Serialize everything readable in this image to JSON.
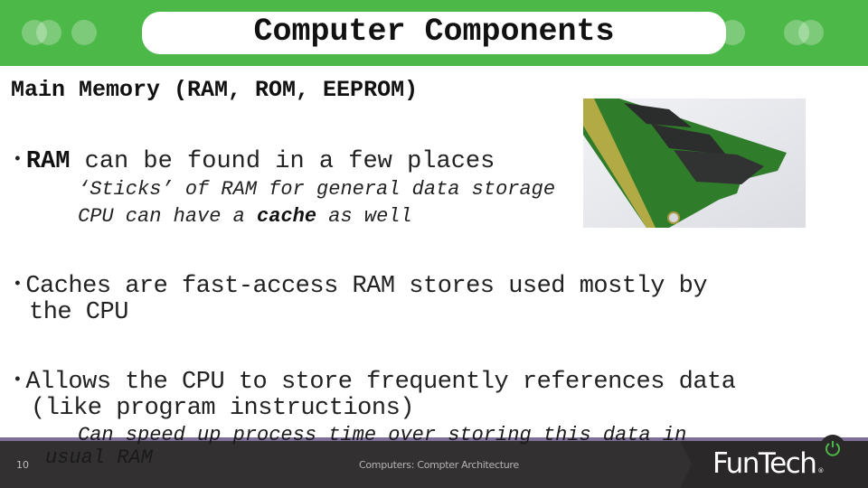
{
  "header": {
    "title": "Computer Components",
    "accent_color": "#4cb847"
  },
  "content": {
    "subtitle": "Main Memory (RAM, ROM, EEPROM)",
    "bullet1": {
      "bold": "RAM",
      "rest": " can be found in a few places",
      "subs": [
        {
          "text": "‘Sticks’ of RAM for general data storage"
        },
        {
          "pre": "CPU can have a ",
          "bold": "cache",
          "post": " as well"
        }
      ]
    },
    "bullet2": {
      "line1": "Caches are fast-access RAM stores used mostly by",
      "line2": "the CPU"
    },
    "bullet3": {
      "line1": "Allows the CPU to store frequently references data",
      "line2": "(like program instructions)",
      "sub_line1": "Can speed up process time over storing this data in",
      "sub_line2": "usual RAM"
    },
    "image": {
      "alt": "RAM stick photo",
      "icon": "ram-module-image"
    }
  },
  "footer": {
    "slide_number": "10",
    "caption": "Computers: Compter Architecture",
    "logo_text": "FunTech",
    "logo_reg": "®",
    "logo_icon": "power-icon",
    "divider_color": "#7e6f98",
    "background_color": "#323031"
  }
}
